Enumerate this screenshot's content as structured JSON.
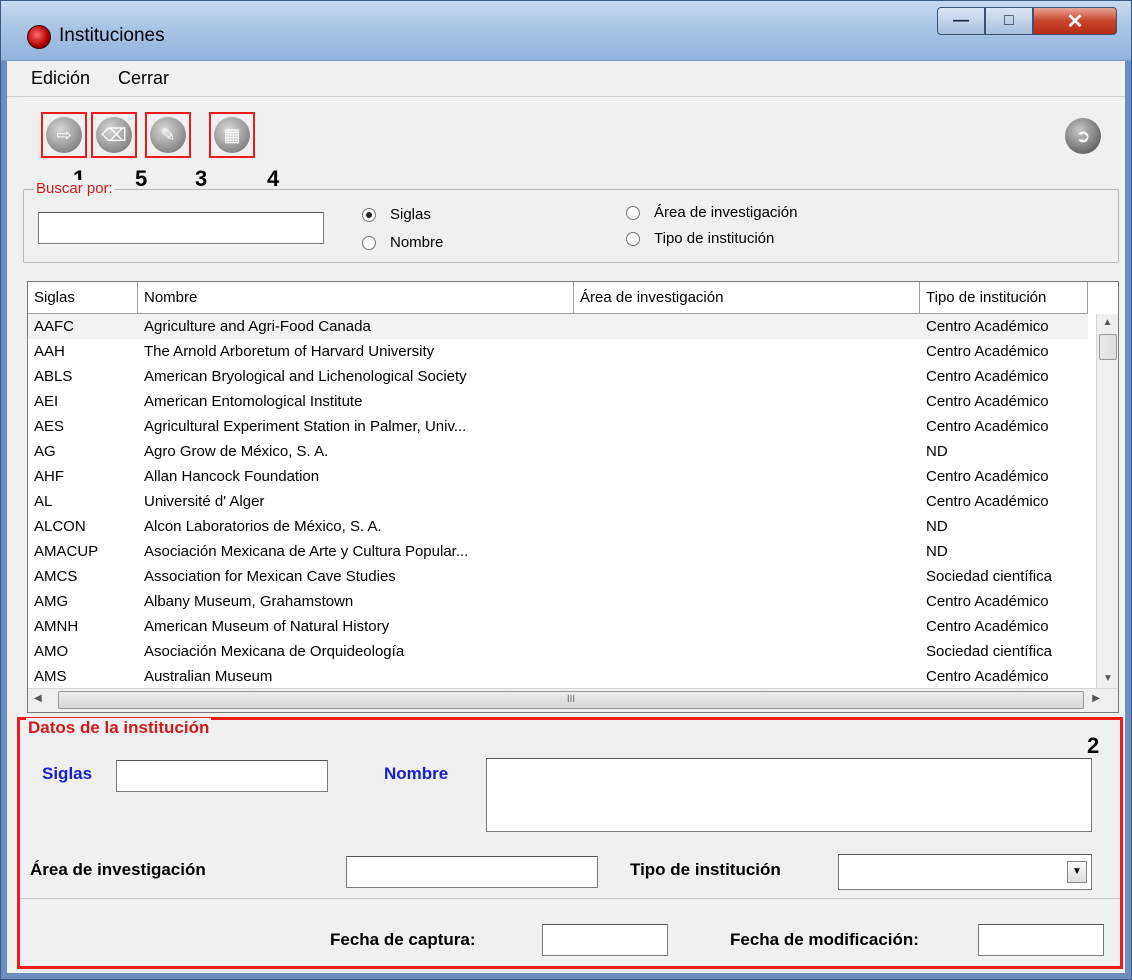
{
  "window": {
    "title": "Instituciones"
  },
  "menu": {
    "items": [
      "Edición",
      "Cerrar"
    ]
  },
  "toolbar": {
    "numbers": [
      "1",
      "5",
      "3",
      "4"
    ],
    "grid_marker": "2"
  },
  "search": {
    "label": "Buscar por:",
    "value": "",
    "options": [
      "Siglas",
      "Nombre",
      "Área de investigación",
      "Tipo de institución"
    ],
    "selected": "Siglas"
  },
  "grid": {
    "columns": [
      "Siglas",
      "Nombre",
      "Área de investigación",
      "Tipo de institución"
    ],
    "rows": [
      [
        "AAFC",
        "Agriculture and Agri-Food Canada",
        "",
        "Centro Académico"
      ],
      [
        "AAH",
        "The Arnold Arboretum of Harvard University",
        "",
        "Centro Académico"
      ],
      [
        "ABLS",
        "American Bryological and Lichenological Society",
        "",
        "Centro Académico"
      ],
      [
        "AEI",
        "American Entomological Institute",
        "",
        "Centro Académico"
      ],
      [
        "AES",
        "Agricultural Experiment Station in Palmer, Univ...",
        "",
        "Centro Académico"
      ],
      [
        "AG",
        "Agro Grow de México, S. A.",
        "",
        "ND"
      ],
      [
        "AHF",
        "Allan Hancock Foundation",
        "",
        "Centro Académico"
      ],
      [
        "AL",
        "Université d' Alger",
        "",
        "Centro Académico"
      ],
      [
        "ALCON",
        "Alcon Laboratorios de México, S. A.",
        "",
        "ND"
      ],
      [
        "AMACUP",
        "Asociación Mexicana de Arte y Cultura Popular...",
        "",
        "ND"
      ],
      [
        "AMCS",
        "Association for Mexican Cave Studies",
        "",
        "Sociedad científica"
      ],
      [
        "AMG",
        "Albany Museum, Grahamstown",
        "",
        "Centro Académico"
      ],
      [
        "AMNH",
        "American Museum of Natural History",
        "",
        "Centro Académico"
      ],
      [
        "AMO",
        "Asociación Mexicana de Orquideología",
        "",
        "Sociedad científica"
      ],
      [
        "AMS",
        "Australian Museum",
        "",
        "Centro Académico"
      ]
    ],
    "scroll_marker": "III"
  },
  "datos": {
    "legend": "Datos de la institución",
    "siglas_label": "Siglas",
    "siglas_value": "",
    "nombre_label": "Nombre",
    "nombre_value": "",
    "area_label": "Área de investigación",
    "area_value": "",
    "tipo_label": "Tipo de institución",
    "tipo_value": "",
    "fecha_captura_label": "Fecha de captura:",
    "fecha_captura_value": "",
    "fecha_modificacion_label": "Fecha de modificación:",
    "fecha_modificacion_value": ""
  },
  "colors": {
    "highlight_red": "#ee1c1c",
    "label_blue": "#1622c9",
    "legend_red": "#d11b1b"
  },
  "icons": [
    "app-icon",
    "add-record-icon",
    "eraser-icon",
    "edit-icon",
    "save-icon",
    "exit-icon"
  ]
}
